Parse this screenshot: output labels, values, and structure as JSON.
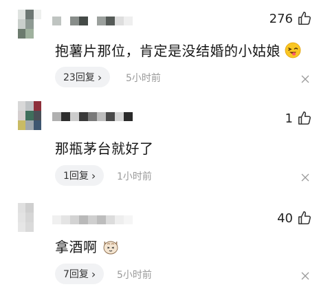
{
  "comments": [
    {
      "likes": "276",
      "text": "抱薯片那位，肯定是没结婚的小姑娘",
      "emoji_icon": "winking-tongue-face-emoji",
      "reply_label": "23回复",
      "reply_chevron": "›",
      "time": "5小时前",
      "avatar_colors": [
        "#dfe3e0",
        "#6d7773",
        "#eef0ee",
        "#c9cfcb",
        "#8e9a93",
        "#ffffff",
        "#6c7b6e",
        "#9fb19e",
        "#ffffff"
      ],
      "name_colors": [
        "#bfc4c1",
        "#ffffff",
        "#888d8a",
        "#444a47",
        "#ffffff",
        "#9ba09d",
        "#555a57",
        "#dedede",
        "#efefef"
      ]
    },
    {
      "likes": "1",
      "text": "那瓶茅台就好了",
      "emoji_icon": "",
      "reply_label": "1回复",
      "reply_chevron": "›",
      "time": "1小时前",
      "avatar_colors": [
        "#d8d8d8",
        "#bfc3c5",
        "#8d2f3a",
        "#d5cfcf",
        "#3f6f5c",
        "#4a4f57",
        "#c9bb64",
        "#9ea6ad",
        "#3e5670"
      ],
      "name_colors": [
        "#b0b0b0",
        "#2e2e2e",
        "#cccccc",
        "#3a3a3a",
        "#7a7a7a",
        "#bdbdbd",
        "#4a4a4a",
        "#d5d5d5",
        "#2a2a2a"
      ]
    },
    {
      "likes": "40",
      "text": "拿酒啊",
      "emoji_icon": "cat-face-emoji",
      "reply_label": "7回复",
      "reply_chevron": "›",
      "time": "5小时前",
      "avatar_colors": [
        "#e0e0e0",
        "#cfcfcf",
        "#ffffff",
        "#e3e3e3",
        "#d6d6d6",
        "#ffffff",
        "#e6e6e6",
        "#dadada",
        "#ffffff"
      ],
      "name_colors": [
        "#f0f0f0",
        "#e4e4e4",
        "#d3d3d3",
        "#b9b9b9",
        "#cfcfcf",
        "#bdbdbd",
        "#dcdcdc",
        "#eeeeee",
        "#f5f5f5"
      ]
    }
  ]
}
